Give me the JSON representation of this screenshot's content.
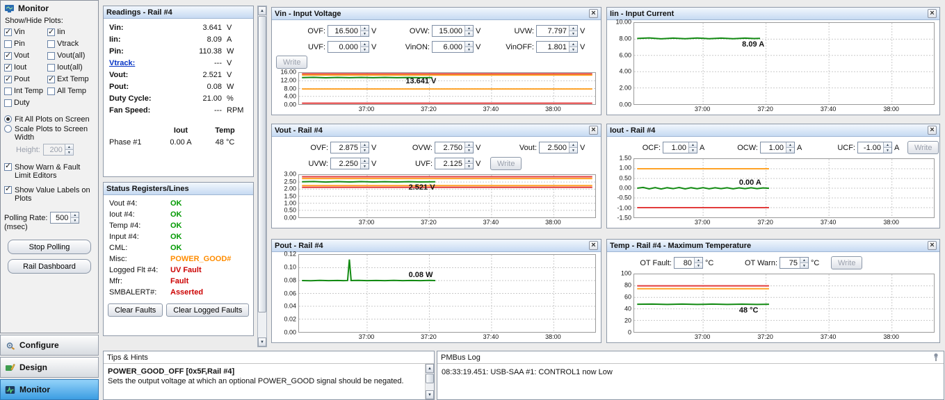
{
  "sidebar": {
    "title": "Monitor",
    "show_hide_label": "Show/Hide Plots:",
    "checks": [
      {
        "label": "Vin",
        "checked": true
      },
      {
        "label": "Iin",
        "checked": true
      },
      {
        "label": "Pin",
        "checked": false
      },
      {
        "label": "Vtrack",
        "checked": false
      },
      {
        "label": "Vout",
        "checked": true
      },
      {
        "label": "Vout(all)",
        "checked": false
      },
      {
        "label": "Iout",
        "checked": true
      },
      {
        "label": "Iout(all)",
        "checked": false
      },
      {
        "label": "Pout",
        "checked": true
      },
      {
        "label": "Ext Temp",
        "checked": true
      },
      {
        "label": "Int Temp",
        "checked": false
      },
      {
        "label": "All Temp",
        "checked": false
      },
      {
        "label": "Duty",
        "checked": false
      }
    ],
    "fit_radio_label": "Fit All Plots on Screen",
    "scale_radio_label": "Scale Plots to Screen Width",
    "height_label": "Height:",
    "height_value": "200",
    "warn_editors_label": "Show Warn & Fault Limit Editors",
    "value_labels_label": "Show Value Labels on Plots",
    "polling_label": "Polling Rate:",
    "polling_value": "500",
    "polling_unit": "(msec)",
    "stop_polling_label": "Stop Polling",
    "rail_dashboard_label": "Rail Dashboard",
    "nav_configure": "Configure",
    "nav_design": "Design",
    "nav_monitor": "Monitor"
  },
  "readings": {
    "title": "Readings - Rail #4",
    "rows": [
      {
        "label": "Vin:",
        "value": "3.641",
        "unit": "V"
      },
      {
        "label": "Iin:",
        "value": "8.09",
        "unit": "A"
      },
      {
        "label": "Pin:",
        "value": "110.38",
        "unit": "W"
      },
      {
        "label": "Vtrack:",
        "value": "---",
        "unit": "V"
      },
      {
        "label": "Vout:",
        "value": "2.521",
        "unit": "V"
      },
      {
        "label": "Pout:",
        "value": "0.08",
        "unit": "W"
      },
      {
        "label": "Duty Cycle:",
        "value": "21.00",
        "unit": "%"
      },
      {
        "label": "Fan Speed:",
        "value": "---",
        "unit": "RPM"
      }
    ],
    "phase_col_iout": "Iout",
    "phase_col_temp": "Temp",
    "phase_row_label": "Phase #1",
    "phase_iout": "0.00 A",
    "phase_temp": "48 °C"
  },
  "status": {
    "title": "Status Registers/Lines",
    "rows": [
      {
        "label": "Vout #4:",
        "value": "OK"
      },
      {
        "label": "Iout #4:",
        "value": "OK"
      },
      {
        "label": "Temp #4:",
        "value": "OK"
      },
      {
        "label": "Input #4:",
        "value": "OK"
      },
      {
        "label": "CML:",
        "value": "OK"
      },
      {
        "label": "Misc:",
        "value": "POWER_GOOD#"
      },
      {
        "label": "Logged Flt #4:",
        "value": "UV Fault"
      },
      {
        "label": "Mfr:",
        "value": "Fault"
      },
      {
        "label": "SMBALERT#:",
        "value": "Asserted"
      }
    ],
    "clear_faults_label": "Clear Faults",
    "clear_logged_label": "Clear Logged Faults"
  },
  "plots": {
    "xticks": [
      "37:00",
      "37:20",
      "37:40",
      "38:00"
    ],
    "write_label": "Write",
    "vin": {
      "title": "Vin - Input Voltage",
      "editors": [
        {
          "label": "OVF:",
          "value": "16.500",
          "unit": "V"
        },
        {
          "label": "OVW:",
          "value": "15.000",
          "unit": "V"
        },
        {
          "label": "UVW:",
          "value": "7.797",
          "unit": "V"
        },
        {
          "label": "UVF:",
          "value": "0.000",
          "unit": "V"
        },
        {
          "label": "VinON:",
          "value": "6.000",
          "unit": "V"
        },
        {
          "label": "VinOFF:",
          "value": "1.801",
          "unit": "V"
        }
      ],
      "yticks": [
        "16.00",
        "12.00",
        "8.00",
        "4.00",
        "0.00"
      ],
      "value_label": "13.641 V"
    },
    "iin": {
      "title": "Iin - Input Current",
      "yticks": [
        "10.00",
        "8.00",
        "6.00",
        "4.00",
        "2.00",
        "0.00"
      ],
      "value_label": "8.09 A"
    },
    "vout": {
      "title": "Vout - Rail #4",
      "editors": [
        {
          "label": "OVF:",
          "value": "2.875",
          "unit": "V"
        },
        {
          "label": "OVW:",
          "value": "2.750",
          "unit": "V"
        },
        {
          "label": "Vout:",
          "value": "2.500",
          "unit": "V"
        },
        {
          "label": "UVW:",
          "value": "2.250",
          "unit": "V"
        },
        {
          "label": "UVF:",
          "value": "2.125",
          "unit": "V"
        }
      ],
      "yticks": [
        "3.00",
        "2.50",
        "2.00",
        "1.50",
        "1.00",
        "0.50",
        "0.00"
      ],
      "value_label": "2.521 V"
    },
    "iout": {
      "title": "Iout - Rail #4",
      "editors": [
        {
          "label": "OCF:",
          "value": "1.00",
          "unit": "A"
        },
        {
          "label": "OCW:",
          "value": "1.00",
          "unit": "A"
        },
        {
          "label": "UCF:",
          "value": "-1.00",
          "unit": "A"
        }
      ],
      "yticks": [
        "1.50",
        "1.00",
        "0.50",
        "0.00",
        "-0.50",
        "-1.00",
        "-1.50"
      ],
      "value_label": "0.00 A"
    },
    "pout": {
      "title": "Pout - Rail #4",
      "yticks": [
        "0.12",
        "0.10",
        "0.08",
        "0.06",
        "0.04",
        "0.02",
        "0.00"
      ],
      "value_label": "0.08 W"
    },
    "temp": {
      "title": "Temp - Rail #4 - Maximum Temperature",
      "editors": [
        {
          "label": "OT Fault:",
          "value": "80",
          "unit": "°C"
        },
        {
          "label": "OT Warn:",
          "value": "75",
          "unit": "°C"
        }
      ],
      "yticks": [
        "100",
        "80",
        "60",
        "40",
        "20",
        "0"
      ],
      "value_label": "48 °C"
    }
  },
  "chart_data": [
    {
      "type": "line",
      "title": "Vin - Input Voltage",
      "ylim": [
        0,
        16
      ],
      "x_ticks": [
        "37:00",
        "37:20",
        "37:40",
        "38:00"
      ],
      "series": [
        {
          "name": "Vin",
          "value": 13.641,
          "color": "#128a12"
        },
        {
          "name": "OVF limit",
          "value": 16.5,
          "color": "#e23b3b"
        },
        {
          "name": "OVW limit",
          "value": 15.0,
          "color": "#ffa226"
        },
        {
          "name": "UVW limit",
          "value": 7.797,
          "color": "#ffa226"
        },
        {
          "name": "UVF limit",
          "value": 0.0,
          "color": "#e23b3b"
        }
      ]
    },
    {
      "type": "line",
      "title": "Iin - Input Current",
      "ylim": [
        0,
        10
      ],
      "x_ticks": [
        "37:00",
        "37:20",
        "37:40",
        "38:00"
      ],
      "series": [
        {
          "name": "Iin",
          "value": 8.09,
          "color": "#128a12"
        }
      ]
    },
    {
      "type": "line",
      "title": "Vout - Rail #4",
      "ylim": [
        0,
        3
      ],
      "x_ticks": [
        "37:00",
        "37:20",
        "37:40",
        "38:00"
      ],
      "series": [
        {
          "name": "Vout",
          "value": 2.521,
          "color": "#128a12"
        },
        {
          "name": "OVF limit",
          "value": 2.875,
          "color": "#e23b3b"
        },
        {
          "name": "OVW limit",
          "value": 2.75,
          "color": "#ffa226"
        },
        {
          "name": "UVW limit",
          "value": 2.25,
          "color": "#ffa226"
        },
        {
          "name": "UVF limit",
          "value": 2.125,
          "color": "#e23b3b"
        }
      ]
    },
    {
      "type": "line",
      "title": "Iout - Rail #4",
      "ylim": [
        -1.5,
        1.5
      ],
      "x_ticks": [
        "37:00",
        "37:20",
        "37:40",
        "38:00"
      ],
      "series": [
        {
          "name": "Iout",
          "value": 0.0,
          "color": "#128a12"
        },
        {
          "name": "OCW limit",
          "value": 1.0,
          "color": "#ffa226"
        },
        {
          "name": "UCF limit",
          "value": -1.0,
          "color": "#e23b3b"
        }
      ]
    },
    {
      "type": "line",
      "title": "Pout - Rail #4",
      "ylim": [
        0,
        0.12
      ],
      "x_ticks": [
        "37:00",
        "37:20",
        "37:40",
        "38:00"
      ],
      "series": [
        {
          "name": "Pout",
          "value": 0.08,
          "peak": 0.115,
          "color": "#128a12"
        }
      ]
    },
    {
      "type": "line",
      "title": "Temp - Rail #4 - Maximum Temperature",
      "ylim": [
        0,
        100
      ],
      "x_ticks": [
        "37:00",
        "37:20",
        "37:40",
        "38:00"
      ],
      "series": [
        {
          "name": "Temp",
          "value": 48,
          "color": "#128a12"
        },
        {
          "name": "OT Fault limit",
          "value": 80,
          "color": "#e23b3b"
        },
        {
          "name": "OT Warn limit",
          "value": 75,
          "color": "#ffa226"
        }
      ]
    }
  ],
  "tips": {
    "title": "Tips & Hints",
    "heading": "POWER_GOOD_OFF [0x5F,Rail #4]",
    "body": "Sets the output voltage at which an optional POWER_GOOD signal should be negated."
  },
  "pmbus": {
    "title": "PMBus Log",
    "log_line": "08:33:19.451: USB-SAA #1: CONTROL1 now Low"
  }
}
